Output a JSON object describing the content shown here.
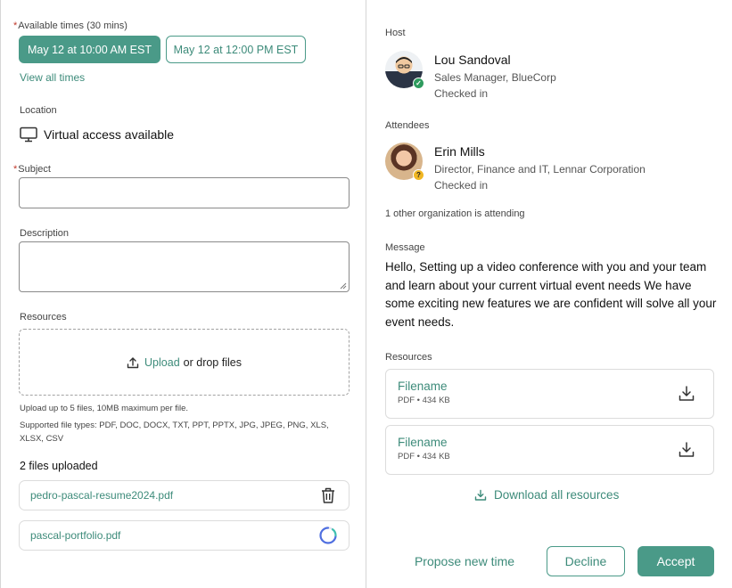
{
  "form": {
    "times_label": "Available times (30 mins)",
    "times": [
      "May 12 at 10:00 AM EST",
      "May 12 at 12:00 PM EST"
    ],
    "view_all": "View all times",
    "location_label": "Location",
    "location_value": "Virtual access available",
    "subject_label": "Subject",
    "subject_value": "",
    "description_label": "Description",
    "description_value": "",
    "resources_label": "Resources",
    "upload_link": "Upload",
    "upload_rest": "or drop files",
    "upload_hint": "Upload up to 5 files, 10MB maximum per file.",
    "file_types": "Supported file types: PDF, DOC, DOCX, TXT, PPT, PPTX, JPG, JPEG, PNG, XLS, XLSX, CSV",
    "uploaded_count": "2 files uploaded",
    "files": [
      "pedro-pascal-resume2024.pdf",
      "pascal-portfolio.pdf"
    ]
  },
  "details": {
    "host_label": "Host",
    "host": {
      "name": "Lou Sandoval",
      "title": "Sales Manager, BlueCorp",
      "status": "Checked in"
    },
    "attendees_label": "Attendees",
    "attendee": {
      "name": "Erin Mills",
      "title": "Director, Finance and IT, Lennar Corporation",
      "status": "Checked in"
    },
    "other_orgs": "1 other organization is attending",
    "message_label": "Message",
    "message": "Hello, Setting up a video conference with you and your team and learn about your current virtual event needs We have some exciting new features we are confident will solve all your event needs.",
    "resources_label": "Resources",
    "resources": [
      {
        "name": "Filename",
        "meta": "PDF • 434 KB"
      },
      {
        "name": "Filename",
        "meta": "PDF • 434 KB"
      }
    ],
    "download_all": "Download all resources"
  },
  "actions": {
    "propose": "Propose new time",
    "decline": "Decline",
    "accept": "Accept"
  },
  "colors": {
    "accent": "#4a9a88",
    "link": "#3d8b7a",
    "checked_badge": "#2e9b5e",
    "pending_badge": "#f0b623"
  },
  "icons": [
    "monitor-icon",
    "upload-icon",
    "trash-icon",
    "loading-spinner-icon",
    "check-badge-icon",
    "pending-badge-icon",
    "download-icon"
  ]
}
